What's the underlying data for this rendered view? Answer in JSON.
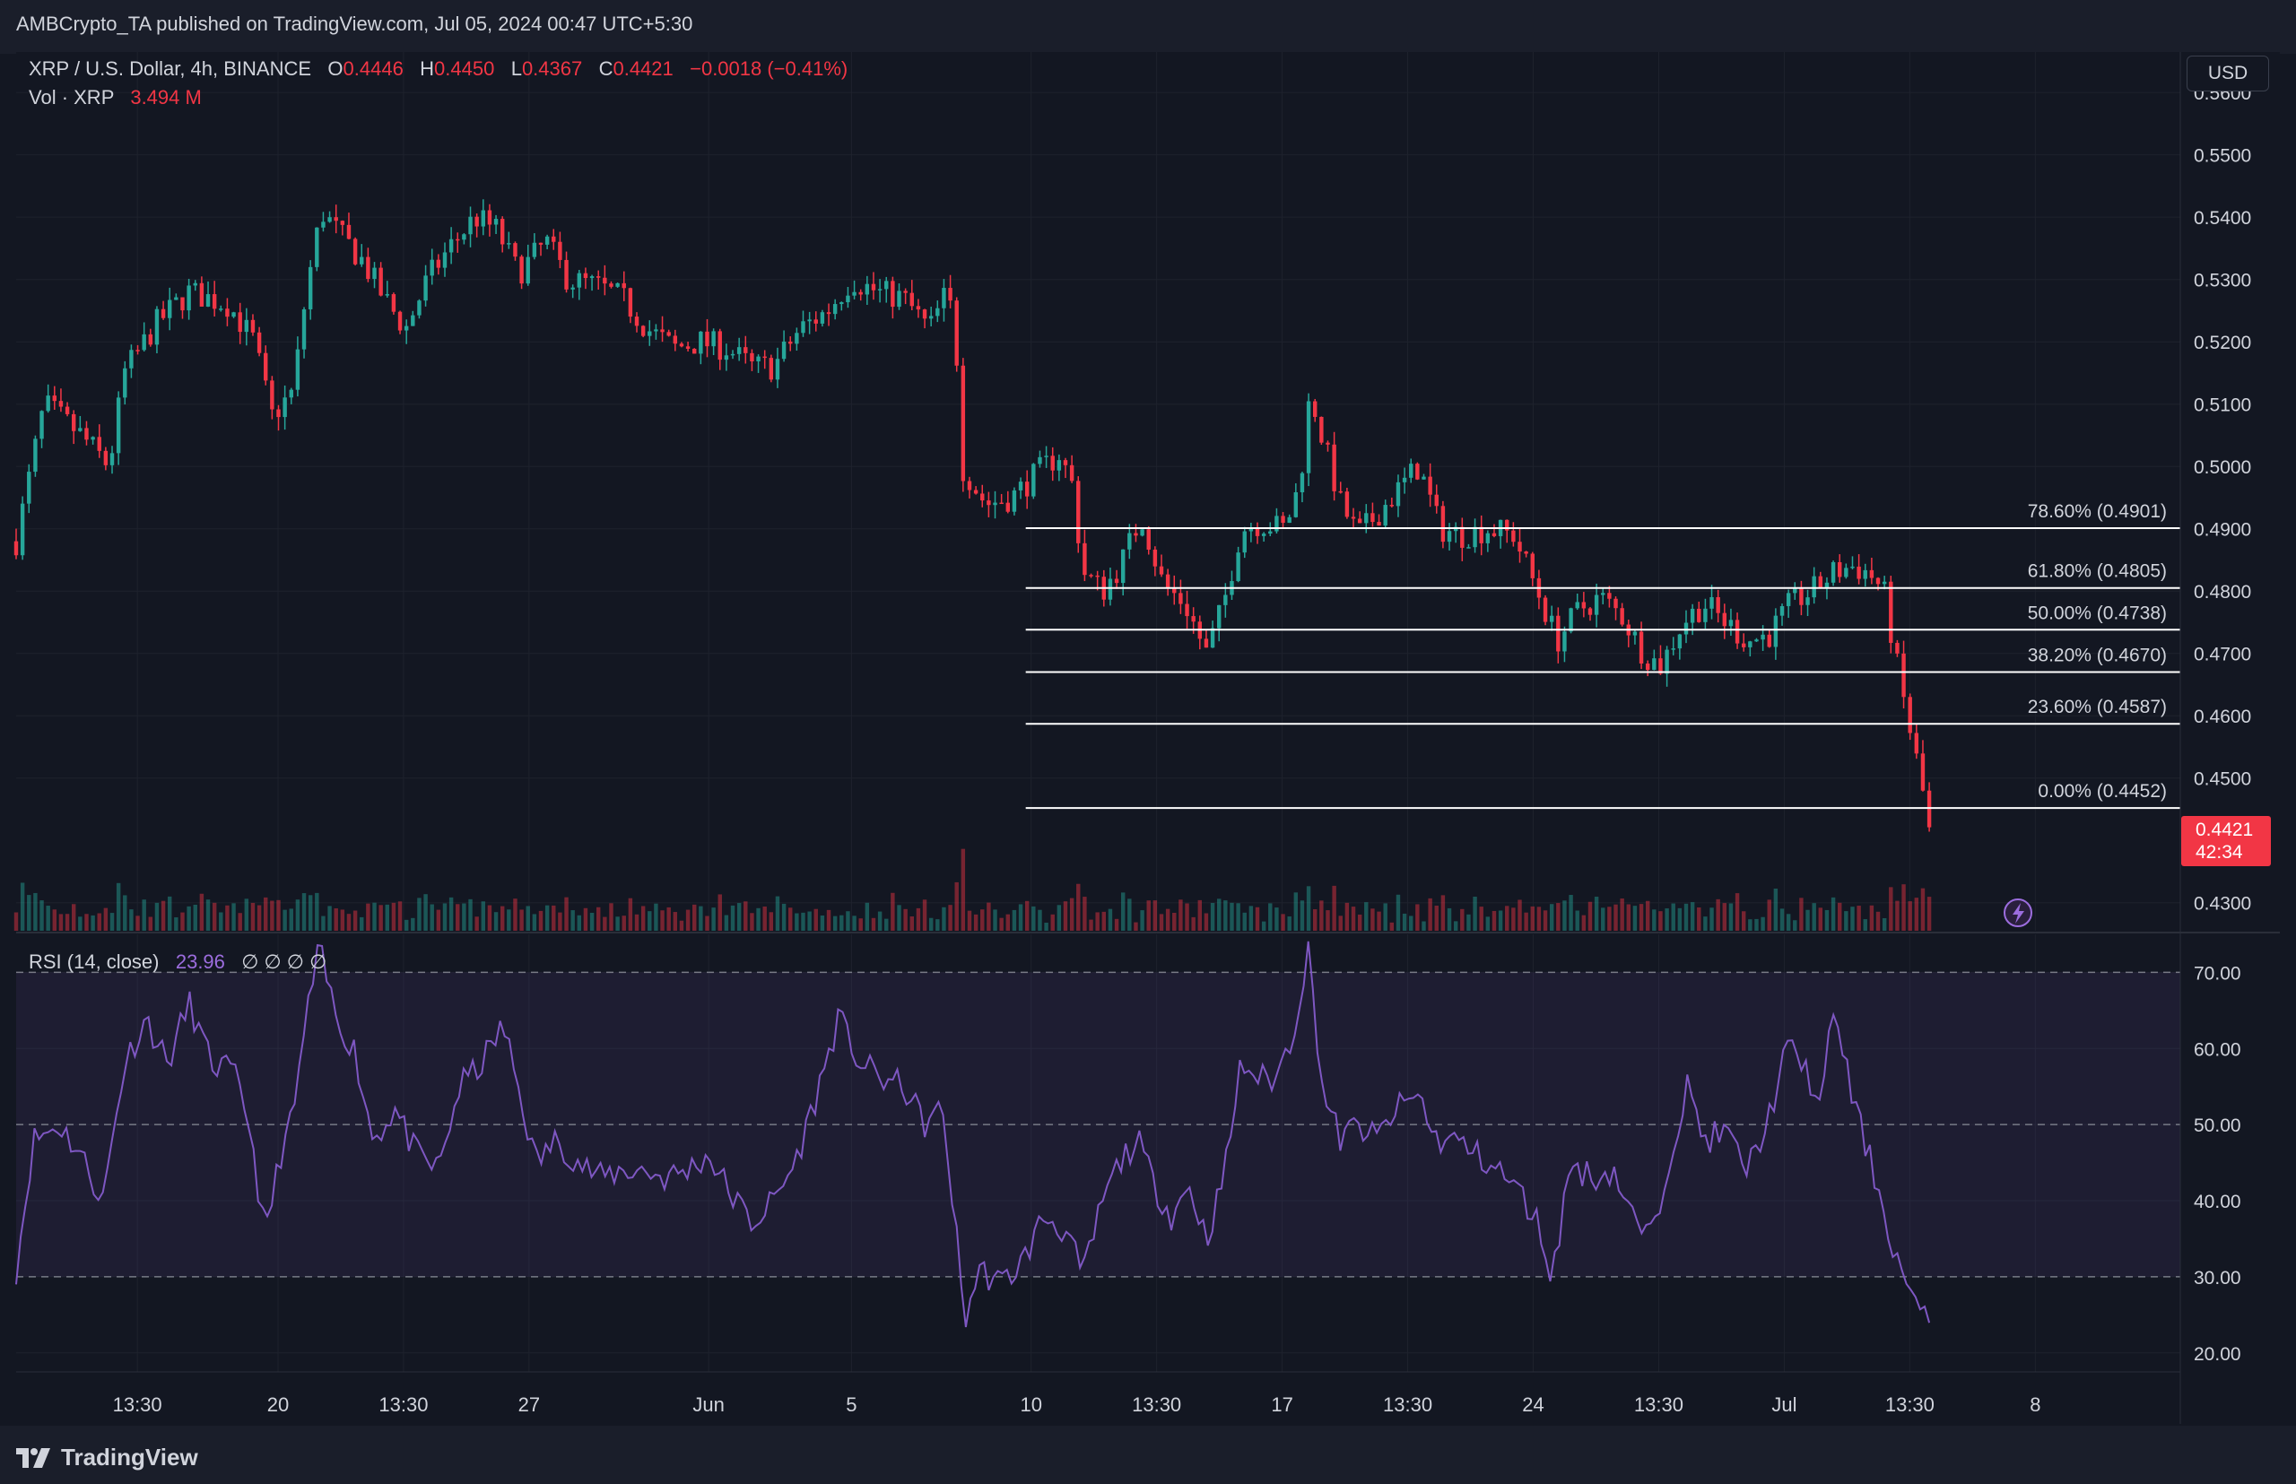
{
  "header": {
    "published": "AMBCrypto_TA published on TradingView.com, Jul 05, 2024 00:47 UTC+5:30"
  },
  "legend": {
    "symbol": "XRP / U.S. Dollar, 4h, BINANCE",
    "o_label": "O",
    "o_value": "0.4446",
    "h_label": "H",
    "h_value": "0.4450",
    "l_label": "L",
    "l_value": "0.4367",
    "c_label": "C",
    "c_value": "0.4421",
    "change": "−0.0018 (−0.41%)",
    "vol_label": "Vol · XRP",
    "vol_value": "3.494 M"
  },
  "currency_button": "USD",
  "rsi_legend": {
    "label": "RSI (14, close)",
    "value": "23.96",
    "extras": "∅ ∅ ∅ ∅"
  },
  "price_tag": {
    "price": "0.4421",
    "countdown": "42:34"
  },
  "footer": {
    "brand": "TradingView"
  },
  "colors": {
    "background": "#131722",
    "up": "#26a69a",
    "down": "#f23645",
    "rsi_line": "#7e57c2",
    "fib_line": "#ffffff"
  },
  "chart_data": [
    {
      "type": "candlestick",
      "title": "XRP / U.S. Dollar, 4h, BINANCE",
      "ylim": [
        0.4255,
        0.5665
      ],
      "y_ticks": [
        "0.5600",
        "0.5500",
        "0.5400",
        "0.5300",
        "0.5200",
        "0.5100",
        "0.5000",
        "0.4900",
        "0.4800",
        "0.4700",
        "0.4600",
        "0.4500",
        "0.4300"
      ],
      "x_ticks": [
        {
          "label": "13:30",
          "x": 0.056
        },
        {
          "label": "20",
          "x": 0.121
        },
        {
          "label": "13:30",
          "x": 0.179
        },
        {
          "label": "27",
          "x": 0.237
        },
        {
          "label": "Jun",
          "x": 0.32
        },
        {
          "label": "5",
          "x": 0.386
        },
        {
          "label": "10",
          "x": 0.469
        },
        {
          "label": "13:30",
          "x": 0.527
        },
        {
          "label": "17",
          "x": 0.585
        },
        {
          "label": "13:30",
          "x": 0.643
        },
        {
          "label": "24",
          "x": 0.701
        },
        {
          "label": "13:30",
          "x": 0.759
        },
        {
          "label": "Jul",
          "x": 0.817
        },
        {
          "label": "13:30",
          "x": 0.875
        },
        {
          "label": "8",
          "x": 0.933
        }
      ],
      "fib_levels": [
        {
          "label": "78.60% (0.4901)",
          "price": 0.4901
        },
        {
          "label": "61.80% (0.4805)",
          "price": 0.4805
        },
        {
          "label": "50.00% (0.4738)",
          "price": 0.4738
        },
        {
          "label": "38.20% (0.4670)",
          "price": 0.467
        },
        {
          "label": "23.60% (0.4587)",
          "price": 0.4587
        },
        {
          "label": "0.00% (0.4452)",
          "price": 0.4452
        }
      ],
      "fib_x_start": 0.4665,
      "last_close": 0.4421,
      "key_path": [
        [
          0.0,
          0.488
        ],
        [
          0.013,
          0.51
        ],
        [
          0.03,
          0.505
        ],
        [
          0.043,
          0.5
        ],
        [
          0.05,
          0.515
        ],
        [
          0.065,
          0.523
        ],
        [
          0.08,
          0.528
        ],
        [
          0.098,
          0.526
        ],
        [
          0.11,
          0.52
        ],
        [
          0.118,
          0.508
        ],
        [
          0.128,
          0.512
        ],
        [
          0.134,
          0.528
        ],
        [
          0.141,
          0.541
        ],
        [
          0.15,
          0.537
        ],
        [
          0.16,
          0.533
        ],
        [
          0.17,
          0.527
        ],
        [
          0.18,
          0.522
        ],
        [
          0.19,
          0.53
        ],
        [
          0.2,
          0.535
        ],
        [
          0.212,
          0.54
        ],
        [
          0.222,
          0.538
        ],
        [
          0.232,
          0.531
        ],
        [
          0.245,
          0.536
        ],
        [
          0.255,
          0.53
        ],
        [
          0.268,
          0.529
        ],
        [
          0.28,
          0.527
        ],
        [
          0.292,
          0.522
        ],
        [
          0.304,
          0.519
        ],
        [
          0.316,
          0.52
        ],
        [
          0.328,
          0.519
        ],
        [
          0.34,
          0.516
        ],
        [
          0.35,
          0.516
        ],
        [
          0.362,
          0.522
        ],
        [
          0.375,
          0.525
        ],
        [
          0.386,
          0.53
        ],
        [
          0.398,
          0.528
        ],
        [
          0.41,
          0.527
        ],
        [
          0.422,
          0.522
        ],
        [
          0.43,
          0.528
        ],
        [
          0.434,
          0.522
        ],
        [
          0.437,
          0.5
        ],
        [
          0.448,
          0.494
        ],
        [
          0.46,
          0.495
        ],
        [
          0.472,
          0.499
        ],
        [
          0.482,
          0.502
        ],
        [
          0.488,
          0.497
        ],
        [
          0.493,
          0.483
        ],
        [
          0.502,
          0.48
        ],
        [
          0.51,
          0.484
        ],
        [
          0.52,
          0.492
        ],
        [
          0.53,
          0.481
        ],
        [
          0.54,
          0.478
        ],
        [
          0.55,
          0.47
        ],
        [
          0.558,
          0.478
        ],
        [
          0.566,
          0.49
        ],
        [
          0.575,
          0.491
        ],
        [
          0.586,
          0.49
        ],
        [
          0.593,
          0.497
        ],
        [
          0.598,
          0.512
        ],
        [
          0.604,
          0.504
        ],
        [
          0.612,
          0.494
        ],
        [
          0.62,
          0.489
        ],
        [
          0.628,
          0.492
        ],
        [
          0.638,
          0.496
        ],
        [
          0.648,
          0.5
        ],
        [
          0.658,
          0.49
        ],
        [
          0.668,
          0.489
        ],
        [
          0.68,
          0.49
        ],
        [
          0.692,
          0.489
        ],
        [
          0.703,
          0.48
        ],
        [
          0.712,
          0.472
        ],
        [
          0.722,
          0.477
        ],
        [
          0.732,
          0.479
        ],
        [
          0.742,
          0.476
        ],
        [
          0.752,
          0.47
        ],
        [
          0.76,
          0.468
        ],
        [
          0.77,
          0.475
        ],
        [
          0.78,
          0.478
        ],
        [
          0.79,
          0.475
        ],
        [
          0.8,
          0.472
        ],
        [
          0.81,
          0.473
        ],
        [
          0.82,
          0.478
        ],
        [
          0.83,
          0.48
        ],
        [
          0.84,
          0.483
        ],
        [
          0.848,
          0.484
        ],
        [
          0.856,
          0.483
        ],
        [
          0.863,
          0.48
        ],
        [
          0.868,
          0.47
        ],
        [
          0.873,
          0.461
        ],
        [
          0.878,
          0.453
        ],
        [
          0.882,
          0.446
        ],
        [
          0.884,
          0.4421
        ]
      ]
    },
    {
      "type": "line",
      "title": "RSI (14, close)",
      "ylim": [
        17.5,
        75
      ],
      "y_ticks": [
        "70.00",
        "60.00",
        "50.00",
        "40.00",
        "30.00",
        "20.00"
      ],
      "band": [
        30,
        70
      ],
      "midline": 50,
      "last_value": 23.96,
      "key_path": [
        [
          0.0,
          31
        ],
        [
          0.008,
          48
        ],
        [
          0.02,
          50
        ],
        [
          0.03,
          46
        ],
        [
          0.04,
          40
        ],
        [
          0.05,
          58
        ],
        [
          0.06,
          64
        ],
        [
          0.07,
          58
        ],
        [
          0.08,
          66
        ],
        [
          0.09,
          58
        ],
        [
          0.1,
          57
        ],
        [
          0.108,
          50
        ],
        [
          0.115,
          35
        ],
        [
          0.122,
          46
        ],
        [
          0.128,
          51
        ],
        [
          0.134,
          64
        ],
        [
          0.14,
          73
        ],
        [
          0.148,
          64
        ],
        [
          0.156,
          60
        ],
        [
          0.165,
          48
        ],
        [
          0.175,
          52
        ],
        [
          0.185,
          46
        ],
        [
          0.195,
          44
        ],
        [
          0.205,
          55
        ],
        [
          0.215,
          58
        ],
        [
          0.225,
          63
        ],
        [
          0.232,
          55
        ],
        [
          0.24,
          45
        ],
        [
          0.25,
          48
        ],
        [
          0.26,
          45
        ],
        [
          0.27,
          43
        ],
        [
          0.28,
          44
        ],
        [
          0.29,
          44
        ],
        [
          0.3,
          43
        ],
        [
          0.31,
          44
        ],
        [
          0.32,
          46
        ],
        [
          0.33,
          41
        ],
        [
          0.34,
          37
        ],
        [
          0.35,
          40
        ],
        [
          0.36,
          45
        ],
        [
          0.37,
          54
        ],
        [
          0.38,
          64
        ],
        [
          0.39,
          58
        ],
        [
          0.4,
          56
        ],
        [
          0.41,
          55
        ],
        [
          0.42,
          50
        ],
        [
          0.428,
          52
        ],
        [
          0.434,
          37
        ],
        [
          0.438,
          24
        ],
        [
          0.445,
          31
        ],
        [
          0.455,
          29
        ],
        [
          0.465,
          32
        ],
        [
          0.475,
          38
        ],
        [
          0.485,
          36
        ],
        [
          0.493,
          30
        ],
        [
          0.502,
          40
        ],
        [
          0.51,
          45
        ],
        [
          0.518,
          48
        ],
        [
          0.526,
          42
        ],
        [
          0.534,
          38
        ],
        [
          0.542,
          42
        ],
        [
          0.55,
          35
        ],
        [
          0.558,
          43
        ],
        [
          0.566,
          58
        ],
        [
          0.575,
          56
        ],
        [
          0.582,
          56
        ],
        [
          0.59,
          62
        ],
        [
          0.597,
          73
        ],
        [
          0.604,
          54
        ],
        [
          0.612,
          48
        ],
        [
          0.62,
          50
        ],
        [
          0.628,
          48
        ],
        [
          0.638,
          52
        ],
        [
          0.648,
          54
        ],
        [
          0.656,
          48
        ],
        [
          0.665,
          48
        ],
        [
          0.675,
          46
        ],
        [
          0.685,
          44
        ],
        [
          0.695,
          41
        ],
        [
          0.703,
          37
        ],
        [
          0.71,
          30
        ],
        [
          0.718,
          45
        ],
        [
          0.728,
          43
        ],
        [
          0.738,
          44
        ],
        [
          0.748,
          37
        ],
        [
          0.756,
          35
        ],
        [
          0.764,
          46
        ],
        [
          0.772,
          55
        ],
        [
          0.78,
          48
        ],
        [
          0.79,
          49
        ],
        [
          0.8,
          44
        ],
        [
          0.81,
          51
        ],
        [
          0.818,
          60
        ],
        [
          0.826,
          58
        ],
        [
          0.834,
          52
        ],
        [
          0.84,
          66
        ],
        [
          0.848,
          54
        ],
        [
          0.856,
          46
        ],
        [
          0.862,
          40
        ],
        [
          0.868,
          33
        ],
        [
          0.874,
          29
        ],
        [
          0.88,
          24.5
        ],
        [
          0.884,
          23.96
        ]
      ]
    }
  ]
}
